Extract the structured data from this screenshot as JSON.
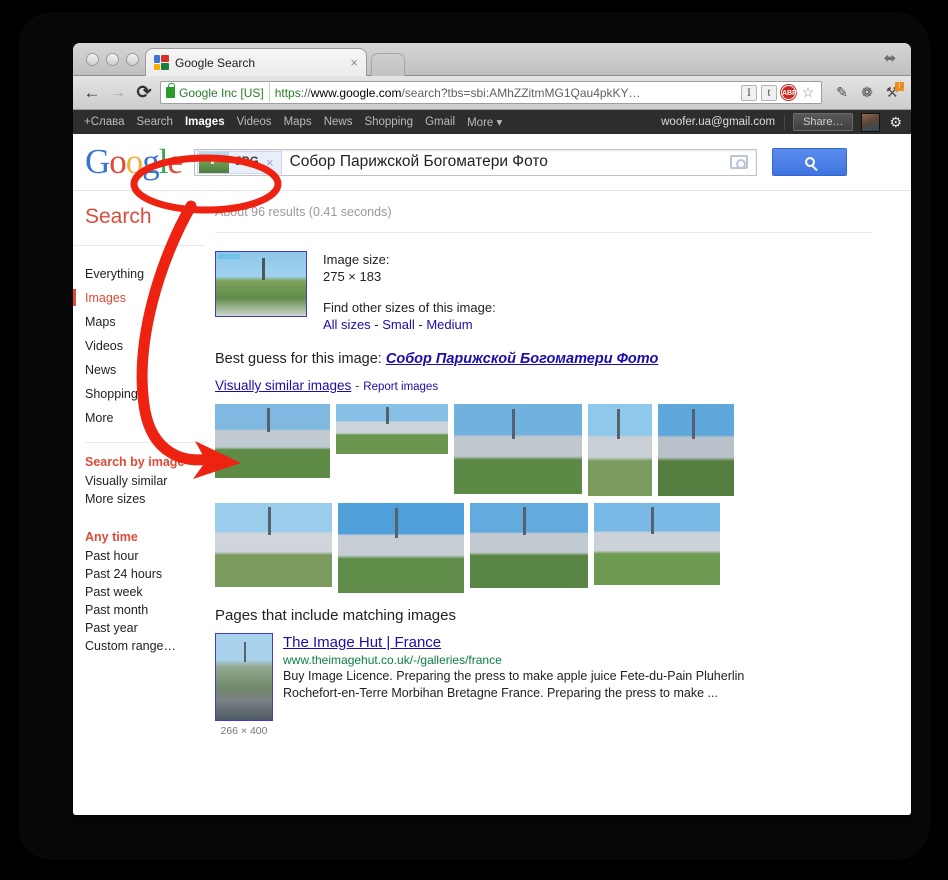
{
  "window": {
    "tab_title": "Google Search",
    "tab_close": "×",
    "maximize_icon": "⬌"
  },
  "omnibox": {
    "back_icon": "←",
    "forward_icon": "→",
    "reload_icon": "⟳",
    "ev_label": "Google Inc [US]",
    "url_scheme": "https",
    "url_sep": "://",
    "url_host": "www.google.com",
    "url_path": "/search?tbs=sbi:AMhZZitmMG1Qau4pkKY…",
    "icon_i": "I",
    "icon_t": "t",
    "icon_abp": "ABP",
    "icon_star": "☆",
    "ext_evernote": "✎",
    "ext_lamp": "❁",
    "ext_wrench": "⚒",
    "ext_wrench_badge": "!"
  },
  "gbar": {
    "links": [
      "+Слава",
      "Search",
      "Images",
      "Videos",
      "Maps",
      "News",
      "Shopping",
      "Gmail",
      "More ▾"
    ],
    "active_index": 2,
    "email": "woofer.ua@gmail.com",
    "share_label": "Share…",
    "gear_icon": "⚙"
  },
  "search": {
    "logo_letters": [
      "G",
      "o",
      "o",
      "g",
      "l",
      "e"
    ],
    "chip_label": "JPG",
    "chip_close": "×",
    "query": "Собор Парижской Богоматери Фото",
    "camera_icon": "camera-icon",
    "search_icon": "search-icon"
  },
  "sidebar": {
    "title": "Search",
    "nav": [
      {
        "label": "Everything",
        "active": false
      },
      {
        "label": "Images",
        "active": true
      },
      {
        "label": "Maps",
        "active": false
      },
      {
        "label": "Videos",
        "active": false
      },
      {
        "label": "News",
        "active": false
      },
      {
        "label": "Shopping",
        "active": false
      },
      {
        "label": "More",
        "active": false
      }
    ],
    "search_by_image": {
      "heading": "Search by image",
      "items": [
        "Visually similar",
        "More sizes"
      ]
    },
    "time": {
      "heading": "Any time",
      "items": [
        "Past hour",
        "Past 24 hours",
        "Past week",
        "Past month",
        "Past year",
        "Custom range…"
      ]
    }
  },
  "main": {
    "result_stats": "About 96 results (0.41 seconds)",
    "image_size_label": "Image size:",
    "image_size_value": "275 × 183",
    "find_other_sizes_label": "Find other sizes of this image:",
    "size_links": [
      "All sizes",
      "Small",
      "Medium"
    ],
    "size_link_sep": " - ",
    "best_guess_label": "Best guess for this image:",
    "best_guess_value": "Собор Парижской Богоматери Фото",
    "visually_similar_link": "Visually similar images",
    "visually_similar_sep": " - ",
    "report_images_link": "Report images",
    "pages_heading": "Pages that include matching images",
    "page_result": {
      "title": "The Image Hut | France",
      "url": "www.theimagehut.co.uk/-/galleries/france",
      "snippet": "Buy Image Licence. Preparing the press to make apple juice Fete-du-Pain Pluherlin Rochefort-en-Terre Morbihan Bretagne France. Preparing the press to make ...",
      "size": "266 × 400"
    },
    "similar_images_rows": [
      [
        {
          "w": 115,
          "h": 74,
          "sky": "#7fb9e2",
          "ground": "#5e8c46",
          "mid": "#c3cbd2"
        },
        {
          "w": 112,
          "h": 50,
          "sky": "#86c0e6",
          "ground": "#6b9650",
          "mid": "#cdd4da"
        },
        {
          "w": 128,
          "h": 90,
          "sky": "#6fb2e0",
          "ground": "#5c8a46",
          "mid": "#bfc7cf"
        },
        {
          "w": 64,
          "h": 92,
          "sky": "#8ec8ea",
          "ground": "#7a9a5e",
          "mid": "#c9d0d6"
        },
        {
          "w": 76,
          "h": 92,
          "sky": "#5fa8dc",
          "ground": "#557f41",
          "mid": "#b9c1ca"
        }
      ],
      [
        {
          "w": 117,
          "h": 84,
          "sky": "#9acdec",
          "ground": "#7a9a5e",
          "mid": "#cfd5da"
        },
        {
          "w": 126,
          "h": 90,
          "sky": "#4f9fdb",
          "ground": "#5f8d49",
          "mid": "#c6cdd3"
        },
        {
          "w": 118,
          "h": 85,
          "sky": "#63abde",
          "ground": "#5a8645",
          "mid": "#c2cad1"
        },
        {
          "w": 126,
          "h": 82,
          "sky": "#78b8e4",
          "ground": "#6f9a52",
          "mid": "#cbd2d8"
        }
      ]
    ]
  },
  "annotation": {
    "color": "#ee2211",
    "ellipse_label": "highlight-ellipse-jpg-chip",
    "arrow_label": "annotation-arrow"
  }
}
